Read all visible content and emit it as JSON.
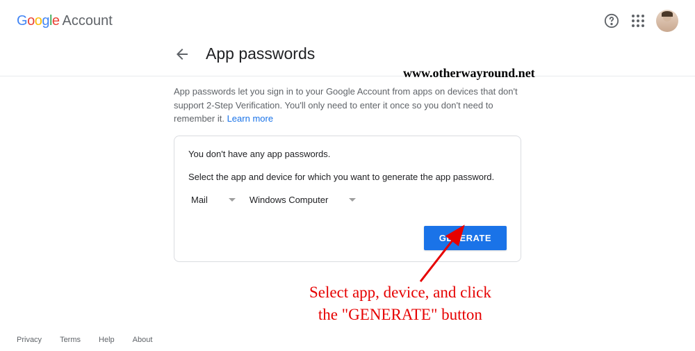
{
  "header": {
    "brand_account": "Account"
  },
  "page": {
    "title": "App passwords",
    "description_part1": "App passwords let you sign in to your Google Account from apps on devices that don't support 2-Step Verification. You'll only need to enter it once so you don't need to remember it. ",
    "learn_more": "Learn more"
  },
  "card": {
    "empty_text": "You don't have any app passwords.",
    "instruction": "Select the app and device for which you want to generate the app password.",
    "app_selected": "Mail",
    "device_selected": "Windows Computer",
    "generate_label": "GENERATE"
  },
  "footer": {
    "privacy": "Privacy",
    "terms": "Terms",
    "help": "Help",
    "about": "About"
  },
  "annotations": {
    "watermark": "www.otherwayround.net",
    "hint": "Select app, device, and click\nthe \"GENERATE\" button"
  }
}
